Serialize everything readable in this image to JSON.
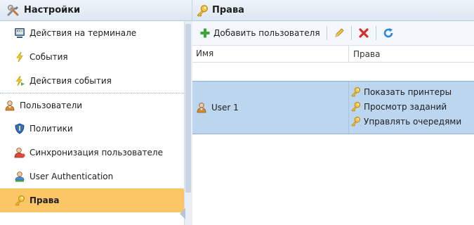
{
  "sidebar": {
    "title": "Настройки",
    "items": [
      {
        "label": "Действия на терминале",
        "icon": "terminal-icon"
      },
      {
        "label": "События",
        "icon": "lightning-icon"
      },
      {
        "label": "Действия события",
        "icon": "event-action-icon"
      },
      {
        "label": "Пользователи",
        "icon": "users-icon"
      },
      {
        "label": "Политики",
        "icon": "shield-icon"
      },
      {
        "label": "Синхронизация пользователе",
        "icon": "user-sync-icon"
      },
      {
        "label": "User Authentication",
        "icon": "user-auth-icon"
      },
      {
        "label": "Права",
        "icon": "key-icon",
        "selected": true
      }
    ]
  },
  "panel": {
    "title": "Права",
    "toolbar": {
      "add_user_label": "Добавить пользователя"
    },
    "columns": {
      "name": "Имя",
      "rights": "Права"
    },
    "rows": [
      {
        "name": "User 1",
        "rights": [
          "Показать принтеры",
          "Просмотр заданий",
          "Управлять очередями"
        ]
      }
    ]
  },
  "colors": {
    "selected_item_bg": "#fbc766",
    "selected_row_bg": "#bcd6f0",
    "header_bg": "#dde7f3"
  }
}
